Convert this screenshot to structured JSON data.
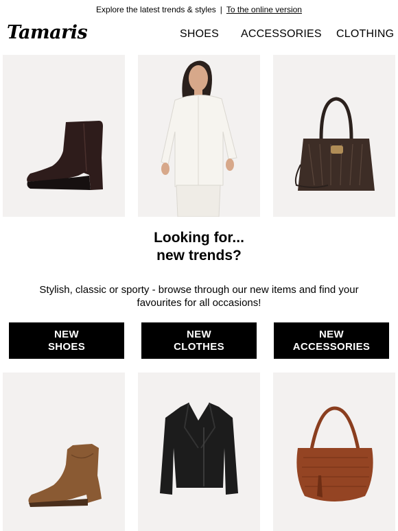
{
  "preheader": {
    "text": "Explore the latest trends & styles",
    "separator": "|",
    "link": "To the online version"
  },
  "brand": {
    "logo": "Tamaris"
  },
  "nav": {
    "items": [
      "SHOES",
      "ACCESSORIES",
      "CLOTHING"
    ]
  },
  "products_top": [
    {
      "icon": "ankle-boot-image"
    },
    {
      "icon": "white-blouse-model-image"
    },
    {
      "icon": "monogram-handbag-image"
    }
  ],
  "hero": {
    "headline_line1": "Looking for...",
    "headline_line2": "new trends?",
    "body": "Stylish, classic or sporty - browse through our new items and find your favourites for all occasions!"
  },
  "cta": [
    {
      "line1": "NEW",
      "line2": "SHOES"
    },
    {
      "line1": "NEW",
      "line2": "CLOTHES"
    },
    {
      "line1": "NEW",
      "line2": "ACCESSORIES"
    }
  ],
  "products_bottom": [
    {
      "icon": "suede-western-boot-image"
    },
    {
      "icon": "leather-jacket-image"
    },
    {
      "icon": "woven-shoulder-bag-image"
    }
  ],
  "colors": {
    "background": "#ffffff",
    "tile": "#f3f1f0",
    "button": "#000000",
    "button_text": "#ffffff"
  }
}
